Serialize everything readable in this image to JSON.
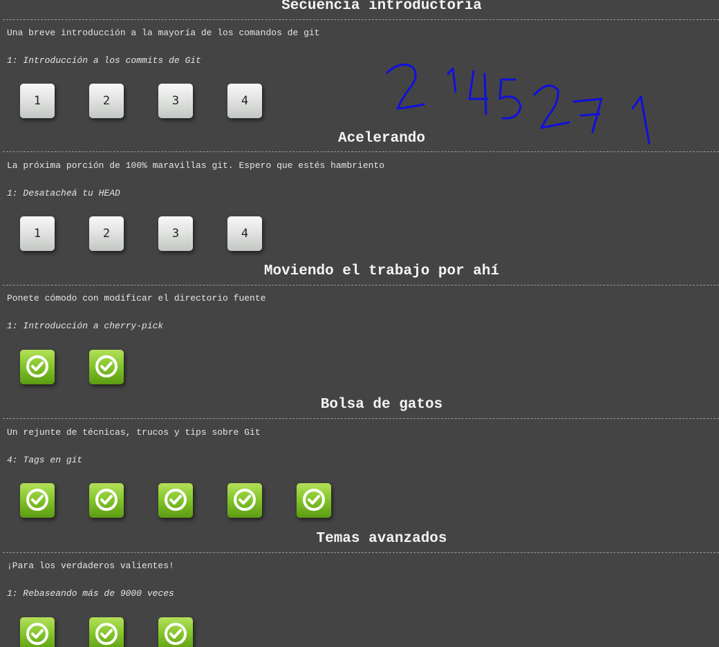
{
  "sections": [
    {
      "title": "Secuencia introductoria",
      "about": "Una breve introducción a la mayoría de los comandos de git",
      "current_level": "1: Introducción a los commits de Git",
      "levels": [
        {
          "label": "1",
          "state": "pending"
        },
        {
          "label": "2",
          "state": "pending"
        },
        {
          "label": "3",
          "state": "pending"
        },
        {
          "label": "4",
          "state": "pending"
        }
      ]
    },
    {
      "title": "Acelerando",
      "about": "La próxima porción de 100% maravillas git. Espero que estés hambriento",
      "current_level": "1: Desatacheá tu HEAD",
      "levels": [
        {
          "label": "1",
          "state": "pending"
        },
        {
          "label": "2",
          "state": "pending"
        },
        {
          "label": "3",
          "state": "pending"
        },
        {
          "label": "4",
          "state": "pending"
        }
      ]
    },
    {
      "title": "Moviendo el trabajo por ahí",
      "about": "Ponete cómodo con modificar el directorio fuente",
      "current_level": "1: Introducción a cherry-pick",
      "levels": [
        {
          "state": "solved",
          "icon": "check-circle-icon"
        },
        {
          "state": "solved",
          "icon": "check-circle-icon"
        }
      ]
    },
    {
      "title": "Bolsa de gatos",
      "about": "Un rejunte de técnicas, trucos y tips sobre Git",
      "current_level": "4: Tags en git",
      "levels": [
        {
          "state": "solved",
          "icon": "check-circle-icon"
        },
        {
          "state": "solved",
          "icon": "check-circle-icon"
        },
        {
          "state": "solved",
          "icon": "check-circle-icon"
        },
        {
          "state": "solved",
          "icon": "check-circle-icon"
        },
        {
          "state": "solved",
          "icon": "check-circle-icon"
        }
      ]
    },
    {
      "title": "Temas avanzados",
      "about": "¡Para los verdaderos valientes!",
      "current_level": "1: Rebaseando más de 9000 veces",
      "levels": [
        {
          "state": "solved",
          "icon": "check-circle-icon"
        },
        {
          "state": "solved",
          "icon": "check-circle-icon"
        },
        {
          "state": "solved",
          "icon": "check-circle-icon"
        }
      ]
    }
  ],
  "annotation": {
    "text": "2145271",
    "color": "#1010dd"
  },
  "colors": {
    "background": "#444444",
    "solved_green": "#86c72d",
    "pending_gray": "#e2e4e2"
  }
}
